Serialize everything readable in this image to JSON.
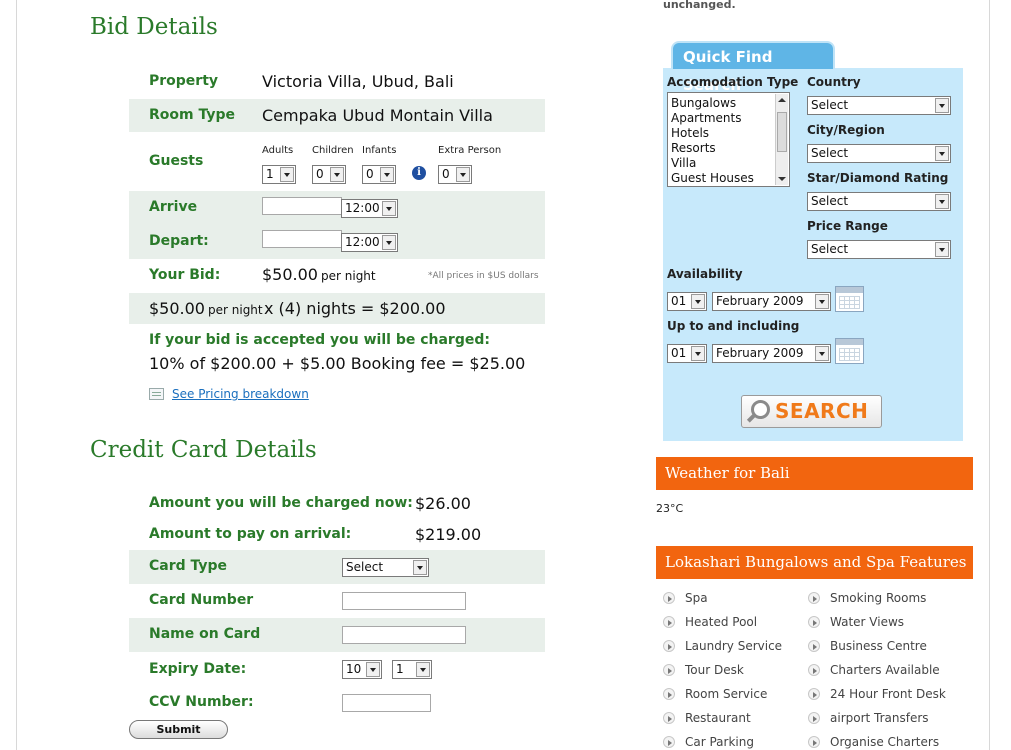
{
  "top_note": "unchanged.",
  "bid": {
    "heading": "Bid Details",
    "property_label": "Property",
    "property_value": "Victoria Villa, Ubud, Bali",
    "room_label": "Room Type",
    "room_value": "Cempaka Ubud Montain Villa",
    "guests_label": "Guests",
    "adults_label": "Adults",
    "children_label": "Children",
    "infants_label": "Infants",
    "extra_label": "Extra Person",
    "adults_value": "1",
    "children_value": "0",
    "infants_value": "0",
    "extra_value": "0",
    "arrive_label": "Arrive",
    "arrive_time": "12:00",
    "depart_label": "Depart:",
    "depart_time": "12:00",
    "your_bid_label": "Your Bid:",
    "your_bid_amount": "$50.00",
    "per_night": "per night",
    "usd_note": "*All prices in $US dollars",
    "calc_amount": "$50.00",
    "calc_rest": "x (4) nights = $200.00",
    "accepted_label": "If your bid is accepted you will be charged:",
    "accepted_calc": "10% of $200.00 + $5.00 Booking fee = $25.00",
    "pricing_link": "See Pricing breakdown"
  },
  "cc": {
    "heading": "Credit Card Details",
    "charged_now_label": "Amount you will be charged now:",
    "charged_now_value": "$26.00",
    "arrival_label": "Amount to pay on arrival:",
    "arrival_value": "$219.00",
    "card_type_label": "Card Type",
    "card_type_value": "Select",
    "card_number_label": "Card Number",
    "name_label": "Name on Card",
    "expiry_label": "Expiry Date:",
    "expiry_month": "10",
    "expiry_year": "1",
    "ccv_label": "CCV Number:",
    "submit_label": "Submit"
  },
  "quick_find": {
    "title": "Quick Find Search",
    "accom_label": "Accomodation Type",
    "accom_items": [
      "Bungalows",
      "Apartments",
      "Hotels",
      "Resorts",
      "Villa",
      "Guest Houses"
    ],
    "country_label": "Country",
    "country_value": "Select",
    "city_label": "City/Region",
    "city_value": "Select",
    "star_label": "Star/Diamond Rating",
    "star_value": "Select",
    "price_label": "Price Range",
    "price_value": "Select",
    "availability_label": "Availability",
    "avail_day": "01",
    "avail_month": "February 2009",
    "upto_label": "Up to and including",
    "upto_day": "01",
    "upto_month": "February 2009",
    "search_label": "SEARCH"
  },
  "weather": {
    "title": "Weather for Bali",
    "temp": "23°C"
  },
  "features": {
    "title": "Lokashari Bungalows and Spa Features",
    "left": [
      "Spa",
      "Heated Pool",
      "Laundry Service",
      "Tour Desk",
      "Room Service",
      "Restaurant",
      "Car Parking"
    ],
    "right": [
      "Smoking Rooms",
      "Water Views",
      "Business Centre",
      "Charters Available",
      "24 Hour Front Desk",
      "airport Transfers",
      "Organise Charters"
    ]
  }
}
